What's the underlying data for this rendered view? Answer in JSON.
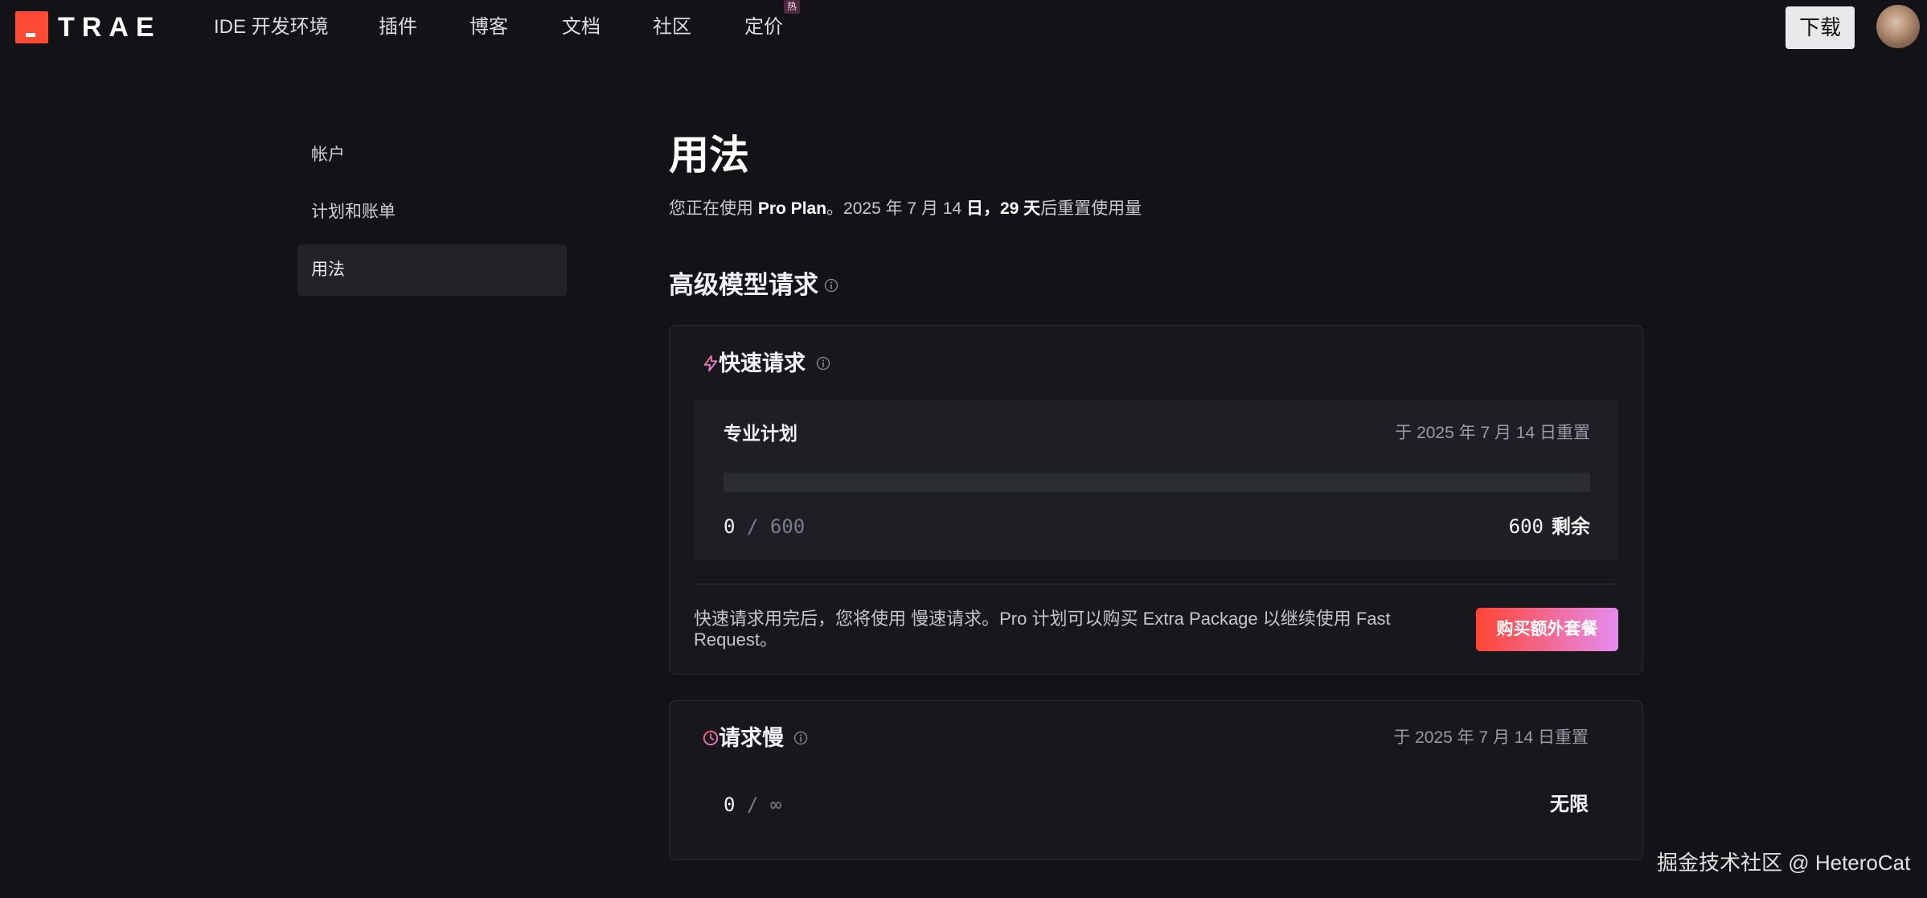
{
  "colors": {
    "page_background": "#121217",
    "logo_red": "#ff4a36",
    "button_gradient_start": "#ff4533",
    "button_gradient_end": "#e48cf0"
  },
  "header": {
    "logo_text": "TRAE",
    "nav": [
      {
        "label": "IDE 开发环境"
      },
      {
        "label": "插件"
      },
      {
        "label": "博客"
      },
      {
        "label": "文档"
      },
      {
        "label": "社区"
      },
      {
        "label": "定价",
        "badge": "热"
      }
    ],
    "download_label": "下载",
    "avatar_icon": "user-avatar"
  },
  "sidebar": {
    "items": [
      {
        "label": "帐户",
        "active": false
      },
      {
        "label": "计划和账单",
        "active": false
      },
      {
        "label": "用法",
        "active": true
      }
    ]
  },
  "main": {
    "title": "用法",
    "subtitle": {
      "prefix": "您正在使用 ",
      "plan": "Pro Plan",
      "middle": "。2025 年 7 月 14 ",
      "emphasis": "日，29 天",
      "suffix": "后重置使用量"
    },
    "section_title": "高级模型请求",
    "fast": {
      "icon": "lightning-icon",
      "title": "快速请求",
      "plan_label": "专业计划",
      "reset_text": "于 2025 年 7 月 14 日重置",
      "progress": 0,
      "used": "0",
      "separator": "/",
      "limit": "600",
      "remaining_value": "600",
      "remaining_label": "剩余",
      "note": "快速请求用完后，您将使用 慢速请求。Pro 计划可以购买 Extra Package 以继续使用 Fast Request。",
      "button_label": "购买额外套餐"
    },
    "slow": {
      "icon": "clock-icon",
      "title": "请求慢",
      "reset_text": "于 2025 年 7 月 14 日重置",
      "used": "0",
      "separator": "/",
      "limit": "∞",
      "status": "无限"
    }
  },
  "watermark": "掘金技术社区 @ HeteroCat"
}
